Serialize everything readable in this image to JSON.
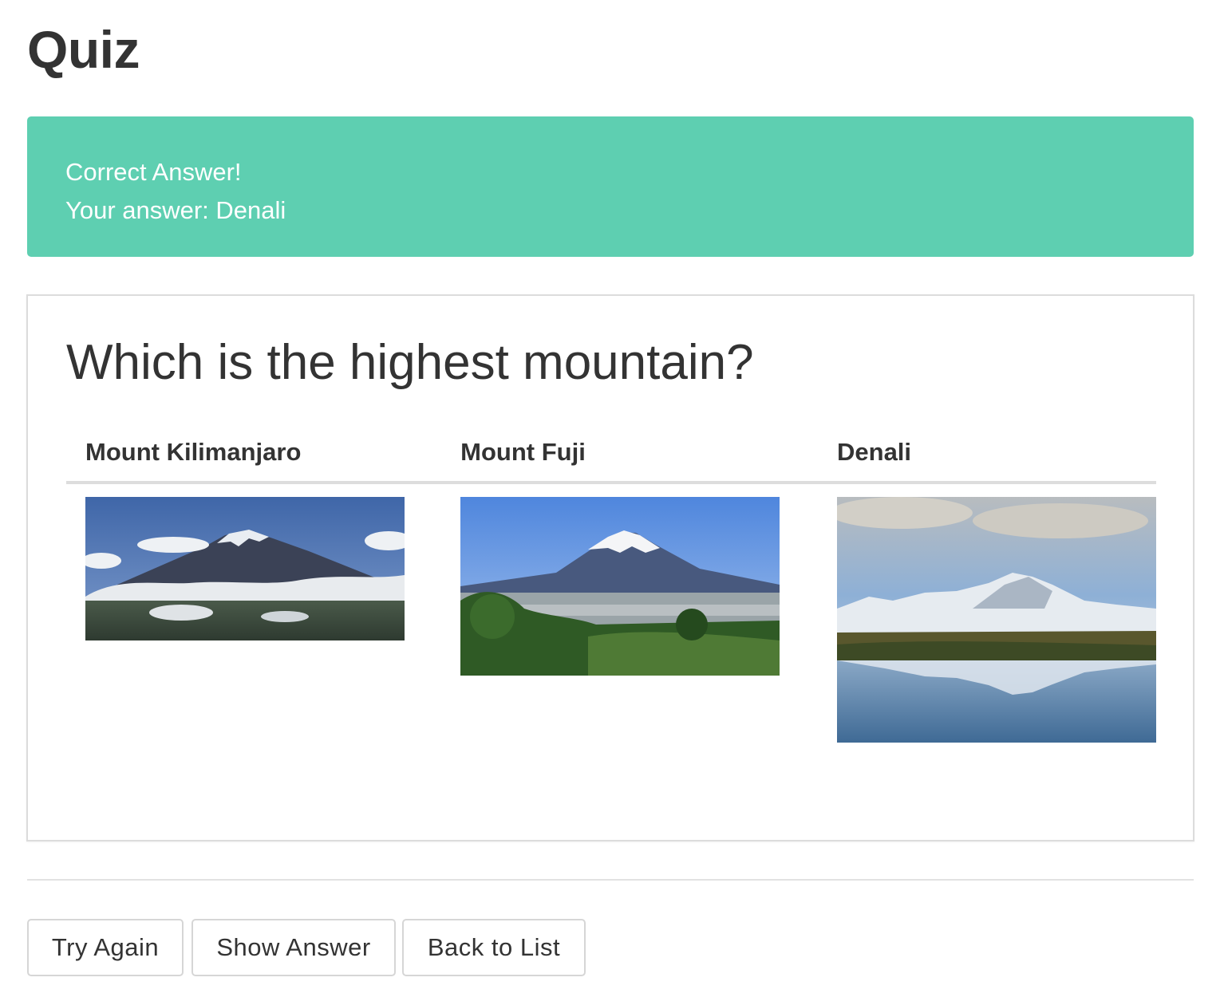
{
  "page": {
    "title": "Quiz"
  },
  "alert": {
    "status": "Correct Answer!",
    "your_answer": "Your answer: Denali",
    "color": "#5ecfb1"
  },
  "question": {
    "text": "Which is the highest mountain?",
    "choices": [
      {
        "label": "Mount Kilimanjaro",
        "image": "mountain-kilimanjaro-photo"
      },
      {
        "label": "Mount Fuji",
        "image": "mountain-fuji-photo"
      },
      {
        "label": "Denali",
        "image": "mountain-denali-photo"
      }
    ]
  },
  "actions": {
    "try_again": "Try Again",
    "show_answer": "Show Answer",
    "back_to_list": "Back to List"
  }
}
